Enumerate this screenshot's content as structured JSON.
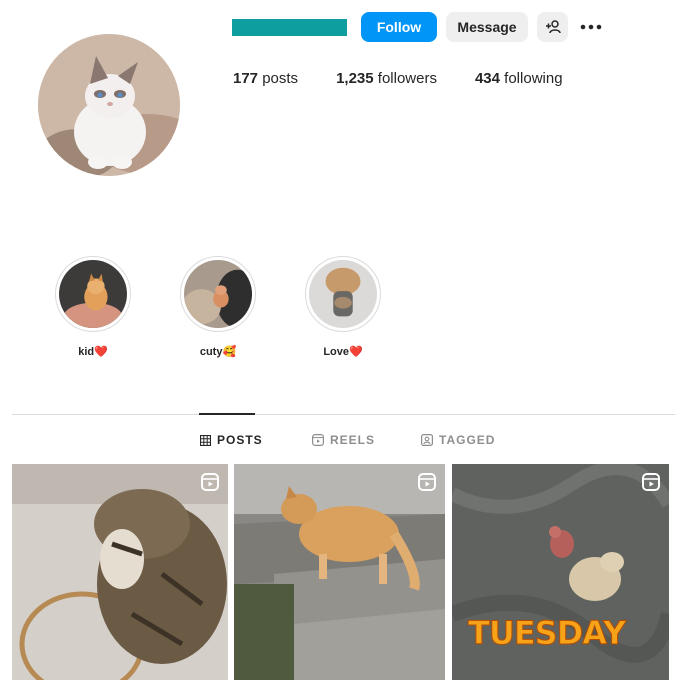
{
  "profile": {
    "avatar_icon": "cat-avatar",
    "username_redaction_color": "#0e9ea0",
    "actions": {
      "follow_label": "Follow",
      "message_label": "Message",
      "suggest_icon": "add-person-icon",
      "more_icon": "more-horizontal-icon"
    },
    "stats": {
      "posts_count": "177",
      "posts_label": "posts",
      "followers_count": "1,235",
      "followers_label": "followers",
      "following_count": "434",
      "following_label": "following"
    }
  },
  "highlights": [
    {
      "label": "kid❤️"
    },
    {
      "label": "cuty🥰"
    },
    {
      "label": "Love❤️"
    }
  ],
  "tabs": [
    {
      "label": "POSTS",
      "icon": "grid-icon",
      "active": true
    },
    {
      "label": "REELS",
      "icon": "reels-icon",
      "active": false
    },
    {
      "label": "TAGGED",
      "icon": "tagged-icon",
      "active": false
    }
  ],
  "posts": [
    {
      "type": "reel",
      "overlay_text": ""
    },
    {
      "type": "reel",
      "overlay_text": ""
    },
    {
      "type": "reel",
      "overlay_text": "TUESDAY"
    }
  ],
  "colors": {
    "follow_blue": "#0095f6",
    "secondary_button": "#efefef",
    "divider": "#dbdbdb",
    "muted_text": "#8e8e8e"
  }
}
